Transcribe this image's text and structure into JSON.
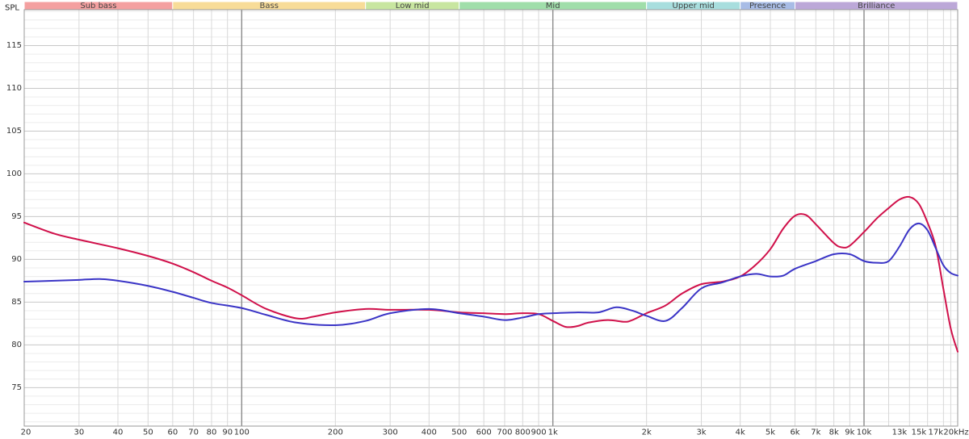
{
  "chart_data": {
    "type": "line",
    "ylabel": "SPL",
    "xscale": "log",
    "xlim": [
      20,
      20000
    ],
    "ylim": [
      70.5,
      119.2
    ],
    "grid": true,
    "bands": [
      {
        "label": "Sub bass",
        "from": 20,
        "to": 60,
        "color": "#f4a0a0"
      },
      {
        "label": "Bass",
        "from": 60,
        "to": 250,
        "color": "#f8dc98"
      },
      {
        "label": "Low mid",
        "from": 250,
        "to": 500,
        "color": "#c8e6a0"
      },
      {
        "label": "Mid",
        "from": 500,
        "to": 2000,
        "color": "#a0deaa"
      },
      {
        "label": "Upper mid",
        "from": 2000,
        "to": 4000,
        "color": "#a8dede"
      },
      {
        "label": "Presence",
        "from": 4000,
        "to": 6000,
        "color": "#a8bce6"
      },
      {
        "label": "Brilliance",
        "from": 6000,
        "to": 20000,
        "color": "#bca8d8"
      }
    ],
    "y_ticks": [
      75,
      80,
      85,
      90,
      95,
      100,
      105,
      110,
      115
    ],
    "x_ticks": [
      {
        "value": 20,
        "label": "20"
      },
      {
        "value": 30,
        "label": "30"
      },
      {
        "value": 40,
        "label": "40"
      },
      {
        "value": 50,
        "label": "50"
      },
      {
        "value": 60,
        "label": "60"
      },
      {
        "value": 70,
        "label": "70"
      },
      {
        "value": 80,
        "label": "80"
      },
      {
        "value": 90,
        "label": "90"
      },
      {
        "value": 100,
        "label": "100"
      },
      {
        "value": 200,
        "label": "200"
      },
      {
        "value": 300,
        "label": "300"
      },
      {
        "value": 400,
        "label": "400"
      },
      {
        "value": 500,
        "label": "500"
      },
      {
        "value": 600,
        "label": "600"
      },
      {
        "value": 700,
        "label": "700"
      },
      {
        "value": 800,
        "label": "800"
      },
      {
        "value": 900,
        "label": "900"
      },
      {
        "value": 1000,
        "label": "1k"
      },
      {
        "value": 2000,
        "label": "2k"
      },
      {
        "value": 3000,
        "label": "3k"
      },
      {
        "value": 4000,
        "label": "4k"
      },
      {
        "value": 5000,
        "label": "5k"
      },
      {
        "value": 6000,
        "label": "6k"
      },
      {
        "value": 7000,
        "label": "7k"
      },
      {
        "value": 8000,
        "label": "8k"
      },
      {
        "value": 9000,
        "label": "9k"
      },
      {
        "value": 10000,
        "label": "10k"
      },
      {
        "value": 13000,
        "label": "13k"
      },
      {
        "value": 15000,
        "label": "15k"
      },
      {
        "value": 17000,
        "label": "17k"
      },
      {
        "value": 20000,
        "label": "20kHz"
      }
    ],
    "series": [
      {
        "color": "#d0104a",
        "points": [
          [
            20,
            94.3
          ],
          [
            25,
            93.0
          ],
          [
            30,
            92.3
          ],
          [
            40,
            91.3
          ],
          [
            50,
            90.4
          ],
          [
            60,
            89.5
          ],
          [
            70,
            88.5
          ],
          [
            80,
            87.5
          ],
          [
            90,
            86.7
          ],
          [
            100,
            85.8
          ],
          [
            120,
            84.2
          ],
          [
            150,
            83.1
          ],
          [
            170,
            83.3
          ],
          [
            200,
            83.8
          ],
          [
            250,
            84.2
          ],
          [
            300,
            84.1
          ],
          [
            400,
            84.1
          ],
          [
            500,
            83.8
          ],
          [
            600,
            83.7
          ],
          [
            700,
            83.6
          ],
          [
            800,
            83.7
          ],
          [
            900,
            83.6
          ],
          [
            1000,
            82.8
          ],
          [
            1100,
            82.1
          ],
          [
            1200,
            82.2
          ],
          [
            1300,
            82.6
          ],
          [
            1500,
            82.9
          ],
          [
            1700,
            82.7
          ],
          [
            1800,
            82.9
          ],
          [
            2000,
            83.7
          ],
          [
            2300,
            84.6
          ],
          [
            2600,
            86.0
          ],
          [
            3000,
            87.1
          ],
          [
            3500,
            87.4
          ],
          [
            4000,
            88.0
          ],
          [
            4500,
            89.4
          ],
          [
            5000,
            91.2
          ],
          [
            5500,
            93.6
          ],
          [
            6000,
            95.1
          ],
          [
            6500,
            95.2
          ],
          [
            7000,
            94.1
          ],
          [
            8000,
            91.9
          ],
          [
            8500,
            91.4
          ],
          [
            9000,
            91.6
          ],
          [
            10000,
            93.2
          ],
          [
            11000,
            94.8
          ],
          [
            12000,
            96.0
          ],
          [
            13000,
            97.0
          ],
          [
            14000,
            97.3
          ],
          [
            15000,
            96.5
          ],
          [
            16000,
            94.3
          ],
          [
            17000,
            91.5
          ],
          [
            18000,
            86.5
          ],
          [
            19000,
            81.9
          ],
          [
            20000,
            79.2
          ]
        ]
      },
      {
        "color": "#3a34c6",
        "points": [
          [
            20,
            87.4
          ],
          [
            25,
            87.5
          ],
          [
            30,
            87.6
          ],
          [
            35,
            87.7
          ],
          [
            40,
            87.5
          ],
          [
            50,
            86.9
          ],
          [
            60,
            86.2
          ],
          [
            70,
            85.5
          ],
          [
            80,
            84.9
          ],
          [
            100,
            84.3
          ],
          [
            120,
            83.5
          ],
          [
            150,
            82.6
          ],
          [
            200,
            82.3
          ],
          [
            250,
            82.8
          ],
          [
            300,
            83.7
          ],
          [
            400,
            84.2
          ],
          [
            500,
            83.7
          ],
          [
            600,
            83.3
          ],
          [
            700,
            82.9
          ],
          [
            800,
            83.2
          ],
          [
            900,
            83.6
          ],
          [
            1000,
            83.7
          ],
          [
            1200,
            83.8
          ],
          [
            1400,
            83.8
          ],
          [
            1600,
            84.4
          ],
          [
            1800,
            84.0
          ],
          [
            2000,
            83.4
          ],
          [
            2300,
            82.8
          ],
          [
            2600,
            84.3
          ],
          [
            3000,
            86.6
          ],
          [
            3500,
            87.3
          ],
          [
            4000,
            88.0
          ],
          [
            4500,
            88.3
          ],
          [
            5000,
            88.0
          ],
          [
            5500,
            88.1
          ],
          [
            6000,
            88.9
          ],
          [
            7000,
            89.8
          ],
          [
            8000,
            90.6
          ],
          [
            9000,
            90.6
          ],
          [
            10000,
            89.8
          ],
          [
            11000,
            89.6
          ],
          [
            12000,
            89.8
          ],
          [
            13000,
            91.5
          ],
          [
            14000,
            93.5
          ],
          [
            15000,
            94.2
          ],
          [
            16000,
            93.4
          ],
          [
            17000,
            91.3
          ],
          [
            18000,
            89.3
          ],
          [
            19000,
            88.4
          ],
          [
            20000,
            88.1
          ]
        ]
      }
    ]
  }
}
